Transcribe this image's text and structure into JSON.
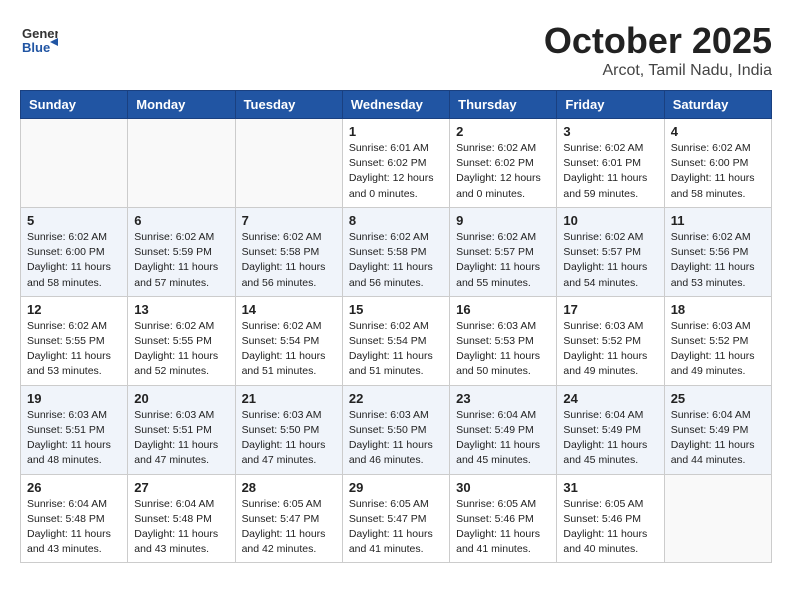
{
  "header": {
    "logo_line1": "General",
    "logo_line2": "Blue",
    "month": "October 2025",
    "location": "Arcot, Tamil Nadu, India"
  },
  "weekdays": [
    "Sunday",
    "Monday",
    "Tuesday",
    "Wednesday",
    "Thursday",
    "Friday",
    "Saturday"
  ],
  "weeks": [
    [
      {
        "day": "",
        "info": ""
      },
      {
        "day": "",
        "info": ""
      },
      {
        "day": "",
        "info": ""
      },
      {
        "day": "1",
        "info": "Sunrise: 6:01 AM\nSunset: 6:02 PM\nDaylight: 12 hours\nand 0 minutes."
      },
      {
        "day": "2",
        "info": "Sunrise: 6:02 AM\nSunset: 6:02 PM\nDaylight: 12 hours\nand 0 minutes."
      },
      {
        "day": "3",
        "info": "Sunrise: 6:02 AM\nSunset: 6:01 PM\nDaylight: 11 hours\nand 59 minutes."
      },
      {
        "day": "4",
        "info": "Sunrise: 6:02 AM\nSunset: 6:00 PM\nDaylight: 11 hours\nand 58 minutes."
      }
    ],
    [
      {
        "day": "5",
        "info": "Sunrise: 6:02 AM\nSunset: 6:00 PM\nDaylight: 11 hours\nand 58 minutes."
      },
      {
        "day": "6",
        "info": "Sunrise: 6:02 AM\nSunset: 5:59 PM\nDaylight: 11 hours\nand 57 minutes."
      },
      {
        "day": "7",
        "info": "Sunrise: 6:02 AM\nSunset: 5:58 PM\nDaylight: 11 hours\nand 56 minutes."
      },
      {
        "day": "8",
        "info": "Sunrise: 6:02 AM\nSunset: 5:58 PM\nDaylight: 11 hours\nand 56 minutes."
      },
      {
        "day": "9",
        "info": "Sunrise: 6:02 AM\nSunset: 5:57 PM\nDaylight: 11 hours\nand 55 minutes."
      },
      {
        "day": "10",
        "info": "Sunrise: 6:02 AM\nSunset: 5:57 PM\nDaylight: 11 hours\nand 54 minutes."
      },
      {
        "day": "11",
        "info": "Sunrise: 6:02 AM\nSunset: 5:56 PM\nDaylight: 11 hours\nand 53 minutes."
      }
    ],
    [
      {
        "day": "12",
        "info": "Sunrise: 6:02 AM\nSunset: 5:55 PM\nDaylight: 11 hours\nand 53 minutes."
      },
      {
        "day": "13",
        "info": "Sunrise: 6:02 AM\nSunset: 5:55 PM\nDaylight: 11 hours\nand 52 minutes."
      },
      {
        "day": "14",
        "info": "Sunrise: 6:02 AM\nSunset: 5:54 PM\nDaylight: 11 hours\nand 51 minutes."
      },
      {
        "day": "15",
        "info": "Sunrise: 6:02 AM\nSunset: 5:54 PM\nDaylight: 11 hours\nand 51 minutes."
      },
      {
        "day": "16",
        "info": "Sunrise: 6:03 AM\nSunset: 5:53 PM\nDaylight: 11 hours\nand 50 minutes."
      },
      {
        "day": "17",
        "info": "Sunrise: 6:03 AM\nSunset: 5:52 PM\nDaylight: 11 hours\nand 49 minutes."
      },
      {
        "day": "18",
        "info": "Sunrise: 6:03 AM\nSunset: 5:52 PM\nDaylight: 11 hours\nand 49 minutes."
      }
    ],
    [
      {
        "day": "19",
        "info": "Sunrise: 6:03 AM\nSunset: 5:51 PM\nDaylight: 11 hours\nand 48 minutes."
      },
      {
        "day": "20",
        "info": "Sunrise: 6:03 AM\nSunset: 5:51 PM\nDaylight: 11 hours\nand 47 minutes."
      },
      {
        "day": "21",
        "info": "Sunrise: 6:03 AM\nSunset: 5:50 PM\nDaylight: 11 hours\nand 47 minutes."
      },
      {
        "day": "22",
        "info": "Sunrise: 6:03 AM\nSunset: 5:50 PM\nDaylight: 11 hours\nand 46 minutes."
      },
      {
        "day": "23",
        "info": "Sunrise: 6:04 AM\nSunset: 5:49 PM\nDaylight: 11 hours\nand 45 minutes."
      },
      {
        "day": "24",
        "info": "Sunrise: 6:04 AM\nSunset: 5:49 PM\nDaylight: 11 hours\nand 45 minutes."
      },
      {
        "day": "25",
        "info": "Sunrise: 6:04 AM\nSunset: 5:49 PM\nDaylight: 11 hours\nand 44 minutes."
      }
    ],
    [
      {
        "day": "26",
        "info": "Sunrise: 6:04 AM\nSunset: 5:48 PM\nDaylight: 11 hours\nand 43 minutes."
      },
      {
        "day": "27",
        "info": "Sunrise: 6:04 AM\nSunset: 5:48 PM\nDaylight: 11 hours\nand 43 minutes."
      },
      {
        "day": "28",
        "info": "Sunrise: 6:05 AM\nSunset: 5:47 PM\nDaylight: 11 hours\nand 42 minutes."
      },
      {
        "day": "29",
        "info": "Sunrise: 6:05 AM\nSunset: 5:47 PM\nDaylight: 11 hours\nand 41 minutes."
      },
      {
        "day": "30",
        "info": "Sunrise: 6:05 AM\nSunset: 5:46 PM\nDaylight: 11 hours\nand 41 minutes."
      },
      {
        "day": "31",
        "info": "Sunrise: 6:05 AM\nSunset: 5:46 PM\nDaylight: 11 hours\nand 40 minutes."
      },
      {
        "day": "",
        "info": ""
      }
    ]
  ]
}
